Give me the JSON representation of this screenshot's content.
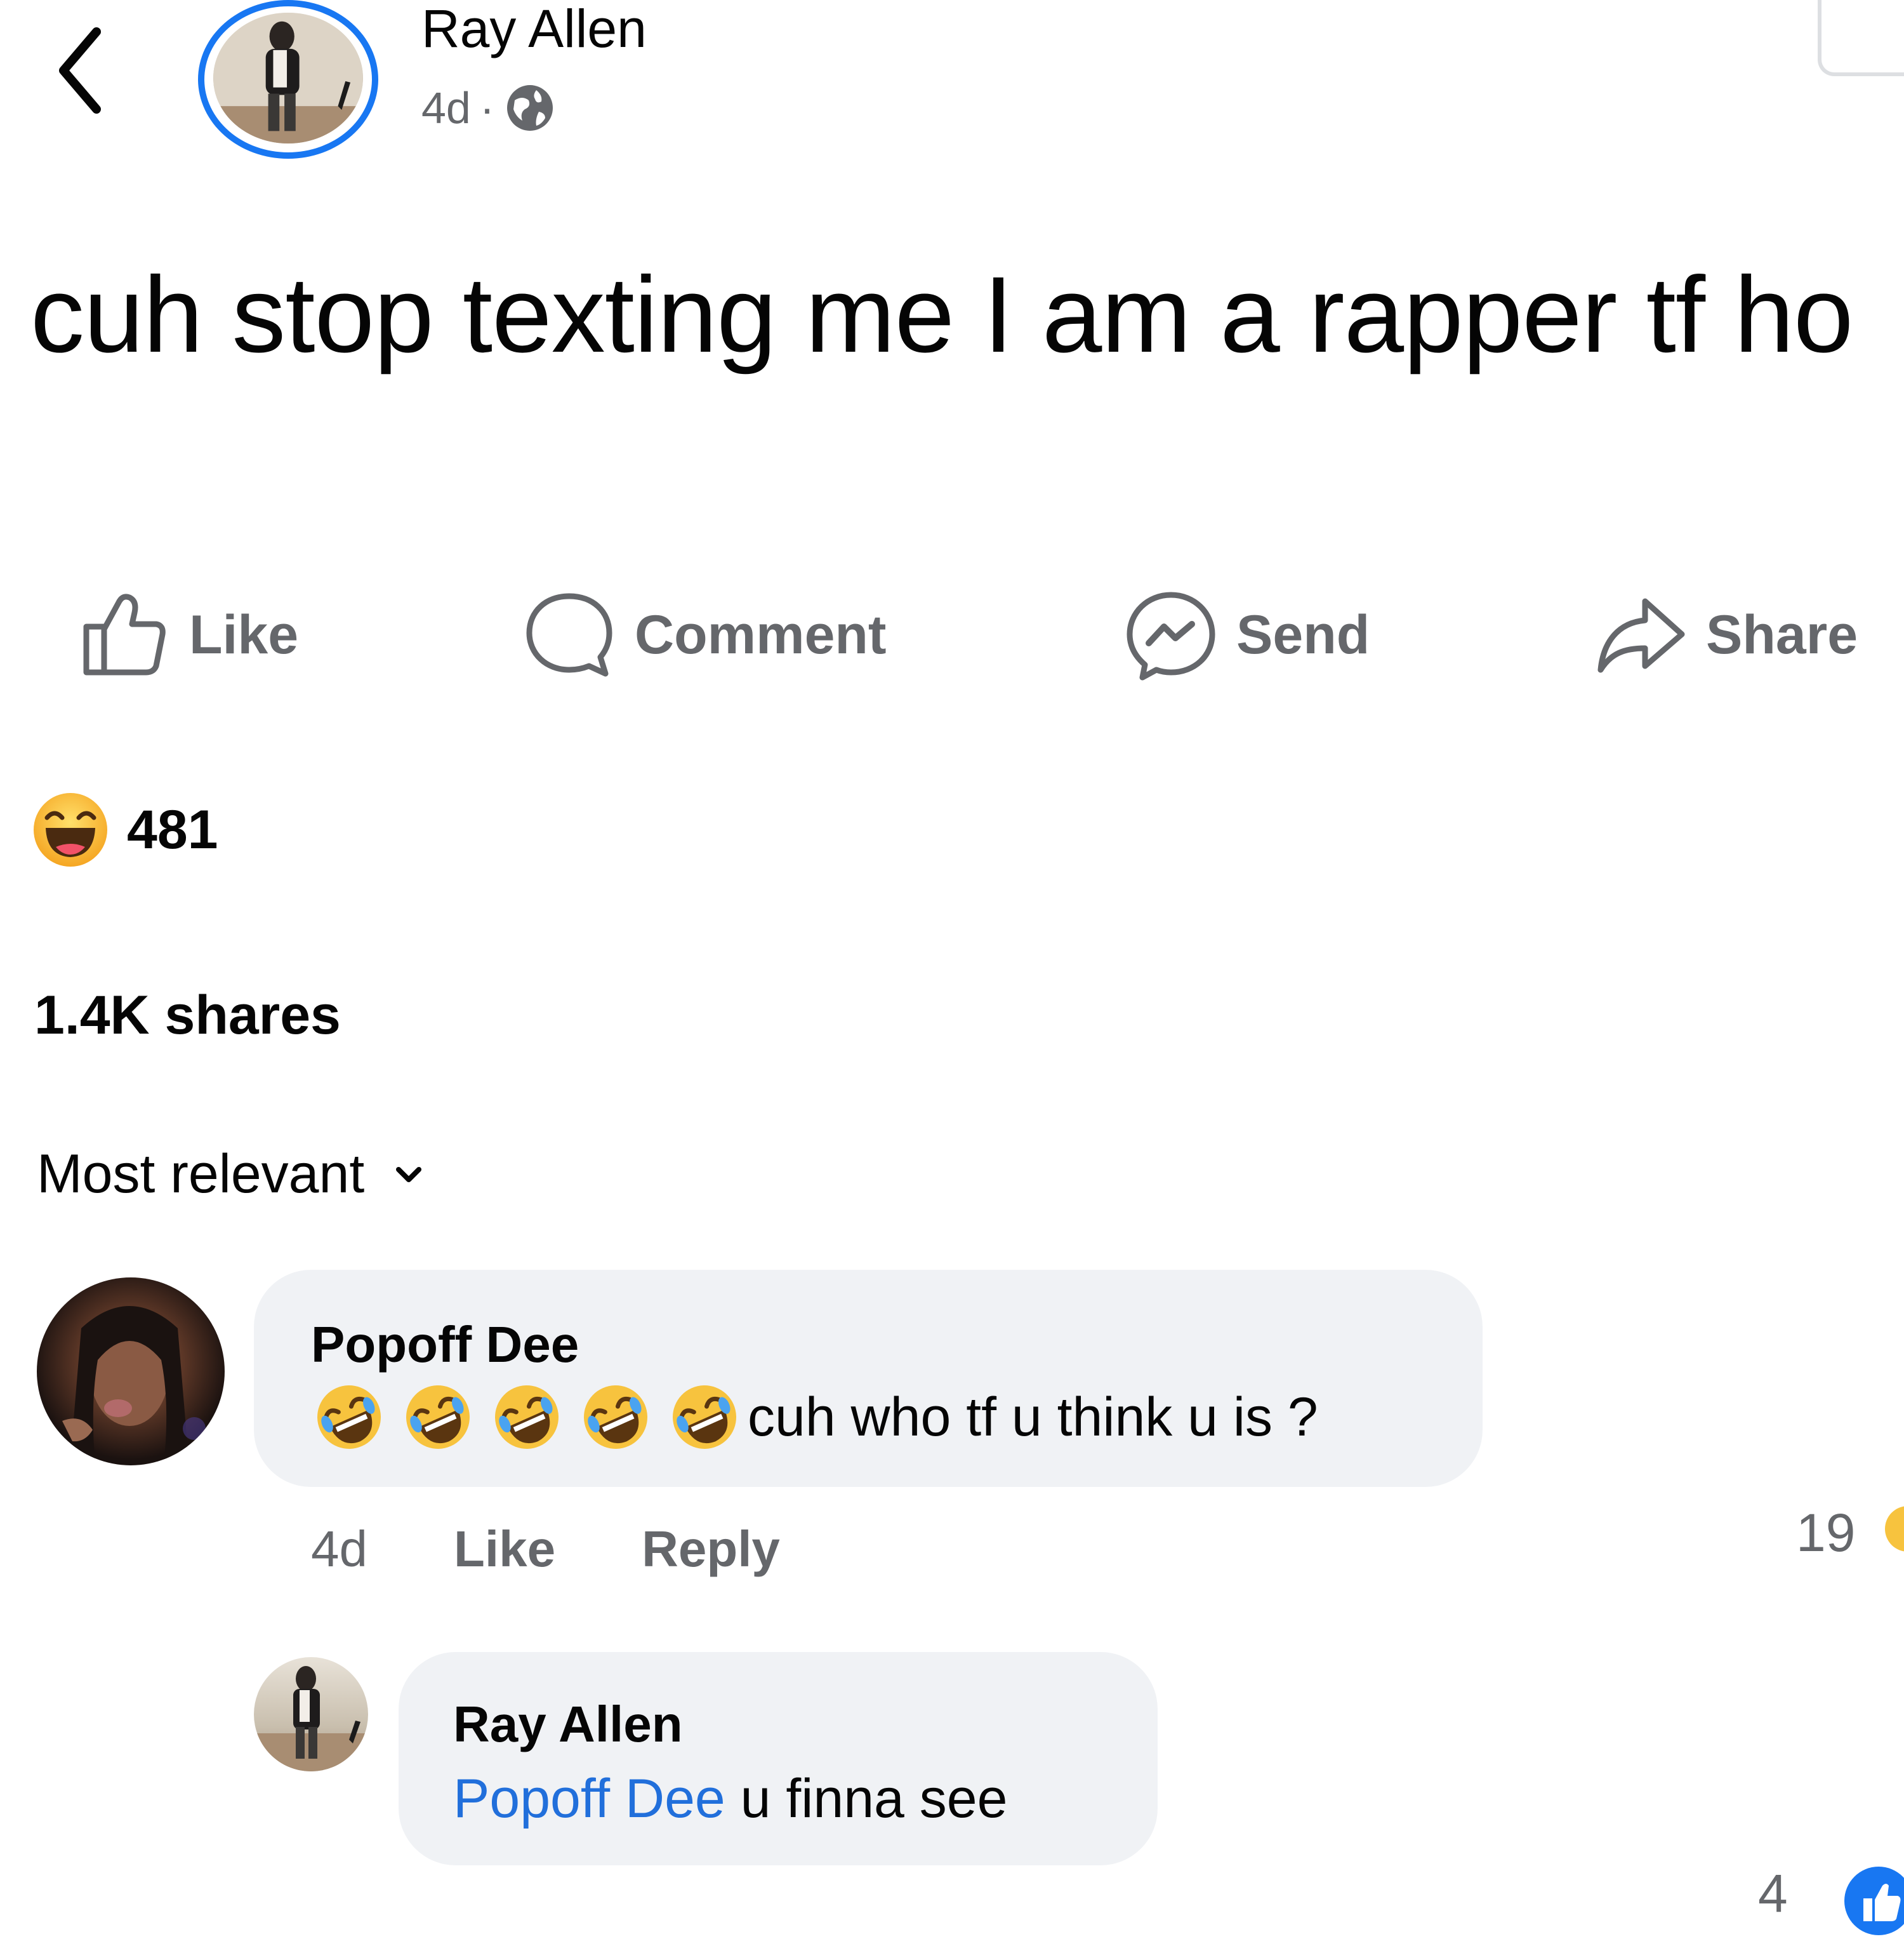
{
  "post": {
    "author": "Ray Allen",
    "time": "4d",
    "separator": "·",
    "text": "cuh stop texting me I am a rapper tf ho"
  },
  "actions": {
    "like": "Like",
    "comment": "Comment",
    "send": "Send",
    "share": "Share"
  },
  "stats": {
    "reaction_count": "481",
    "shares": "1.4K shares"
  },
  "sort": {
    "label": "Most relevant"
  },
  "comments": [
    {
      "author": "Popoff Dee",
      "emoji_count": 5,
      "text": "cuh who tf u think u is ?",
      "time": "4d",
      "like_label": "Like",
      "reply_label": "Reply",
      "reaction_count": "19",
      "reply": {
        "author": "Ray Allen",
        "mention": "Popoff Dee",
        "text": "u finna see",
        "reaction_count": "4"
      }
    }
  ],
  "colors": {
    "accent": "#1877f2",
    "mention": "#216fdb",
    "muted": "#65676b",
    "bubble": "#f0f2f5"
  },
  "icons": [
    "back-icon",
    "globe-icon",
    "like-icon",
    "comment-icon",
    "messenger-icon",
    "share-icon",
    "haha-icon",
    "chevron-down-icon",
    "rofl-icon"
  ]
}
